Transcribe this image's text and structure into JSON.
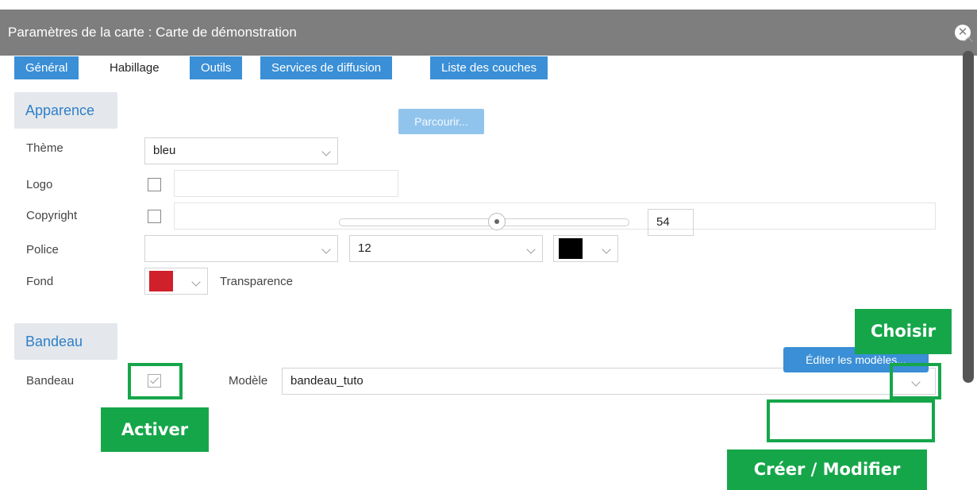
{
  "window": {
    "title": "Paramètres de la carte : Carte de démonstration",
    "close_icon": "close-icon",
    "titlebar_color": "#7e7e7e"
  },
  "tabs": [
    {
      "label": "Général",
      "active": false
    },
    {
      "label": "Habillage",
      "active": true
    },
    {
      "label": "Outils",
      "active": false
    },
    {
      "label": "Services de diffusion",
      "active": false
    },
    {
      "label": "Liste des couches",
      "active": false
    }
  ],
  "appearance": {
    "header": "Apparence",
    "theme": {
      "label": "Thème",
      "value": "bleu"
    },
    "logo": {
      "label": "Logo",
      "checked": false,
      "value": "",
      "browse_label": "Parcourir..."
    },
    "copyright": {
      "label": "Copyright",
      "checked": false,
      "value": ""
    },
    "font": {
      "label": "Police",
      "family": "",
      "size": "12",
      "color": "#000000"
    },
    "background": {
      "label": "Fond",
      "color": "#d0202a",
      "transparency_label": "Transparence",
      "transparency_value": "54",
      "slider_value": 0.54
    }
  },
  "banner": {
    "header": "Bandeau",
    "label": "Bandeau",
    "enabled": true,
    "model_label": "Modèle",
    "model_value": "bandeau_tuto",
    "edit_button": "Éditer les modèles..."
  },
  "annotations": {
    "accent_color": "#16a64a",
    "choisir": "Choisir",
    "activer": "Activer",
    "creer_modifier": "Créer / Modifier"
  },
  "colors": {
    "accent_blue": "#3a8fd6",
    "section_header_text": "#2e7fc8"
  }
}
